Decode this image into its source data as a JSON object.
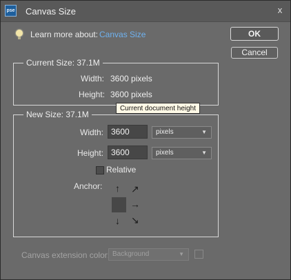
{
  "window": {
    "app_icon_text": "pse",
    "title": "Canvas Size",
    "close_glyph": "x"
  },
  "learn": {
    "prefix": "Learn more about:",
    "link": "Canvas Size"
  },
  "buttons": {
    "ok": "OK",
    "cancel": "Cancel"
  },
  "current_size": {
    "legend": "Current Size: 37.1M",
    "width_label": "Width:",
    "width_value": "3600 pixels",
    "height_label": "Height:",
    "height_value": "3600 pixels"
  },
  "tooltip": "Current document height",
  "new_size": {
    "legend": "New Size: 37.1M",
    "width_label": "Width:",
    "width_value": "3600",
    "width_unit": "pixels",
    "height_label": "Height:",
    "height_value": "3600",
    "height_unit": "pixels",
    "relative_label": "Relative",
    "relative_checked": false,
    "anchor_label": "Anchor:"
  },
  "extension": {
    "label": "Canvas extension color:",
    "value": "Background"
  },
  "icons": {
    "app": "pse-app-icon",
    "close": "close-icon",
    "bulb": "lightbulb-icon",
    "dropdown": "chevron-down-icon",
    "arrows": [
      "arrow-up-icon",
      "arrow-up-right-icon",
      "arrow-right-icon",
      "arrow-down-right-icon",
      "arrow-down-icon"
    ]
  },
  "colors": {
    "link": "#6fb2f0",
    "tooltip_bg": "#fff9e6",
    "dialog_bg": "#6a6a6a"
  }
}
